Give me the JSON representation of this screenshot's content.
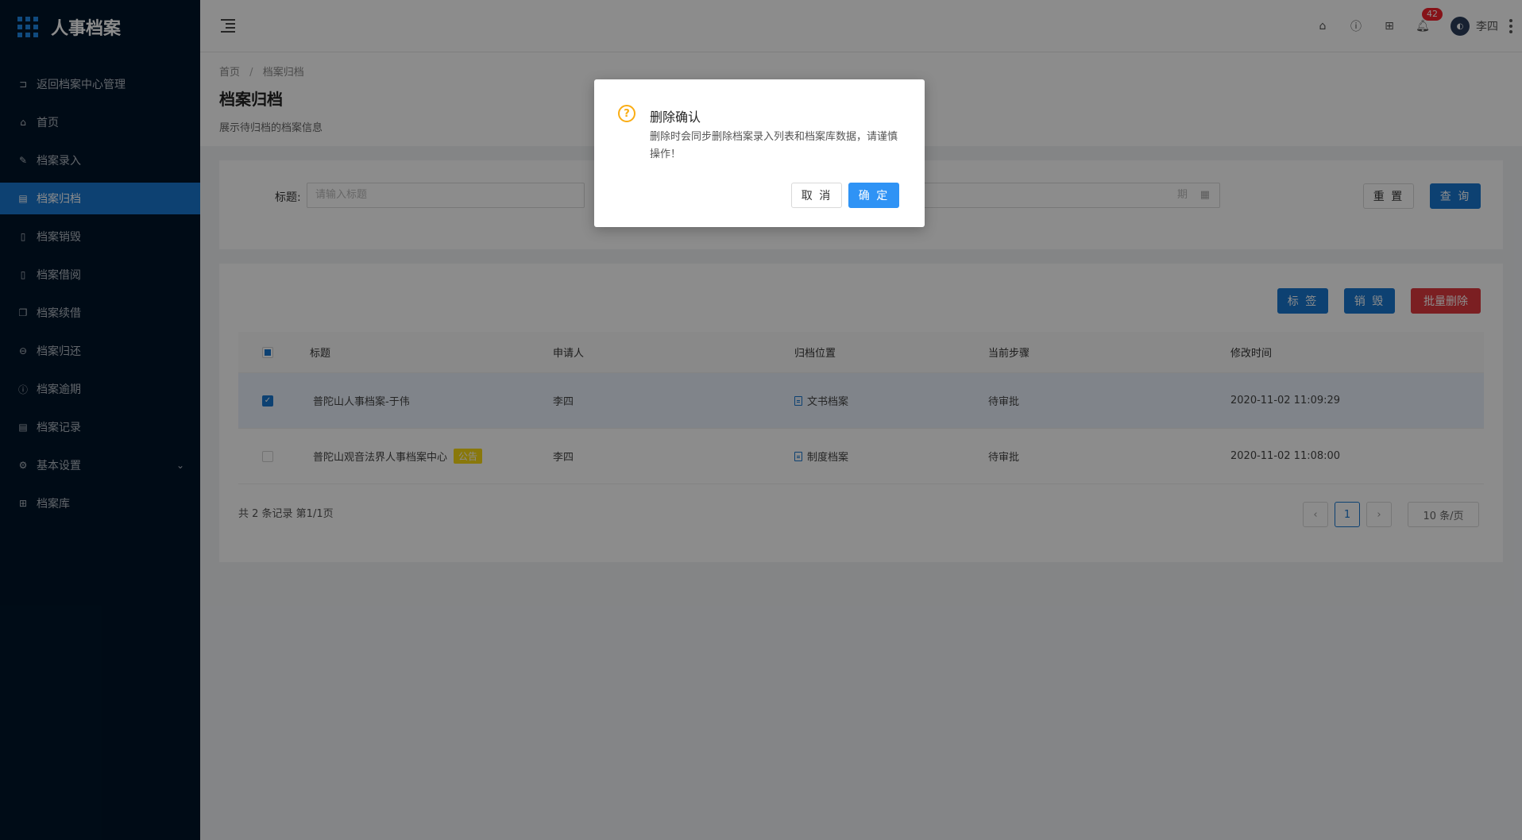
{
  "app": {
    "title": "人事档案"
  },
  "sidebar": {
    "items": [
      {
        "label": "返回档案中心管理",
        "icon": "return-icon"
      },
      {
        "label": "首页",
        "icon": "home-icon"
      },
      {
        "label": "档案录入",
        "icon": "edit-icon"
      },
      {
        "label": "档案归档",
        "icon": "archive-icon",
        "active": true
      },
      {
        "label": "档案销毁",
        "icon": "trash-icon"
      },
      {
        "label": "档案借阅",
        "icon": "file-icon"
      },
      {
        "label": "档案续借",
        "icon": "copy-icon"
      },
      {
        "label": "档案归还",
        "icon": "lock-icon"
      },
      {
        "label": "档案逾期",
        "icon": "alert-icon"
      },
      {
        "label": "档案记录",
        "icon": "record-icon"
      },
      {
        "label": "基本设置",
        "icon": "gear-icon",
        "has_submenu": true
      },
      {
        "label": "档案库",
        "icon": "grid-icon"
      }
    ]
  },
  "header": {
    "notifications_count": "42",
    "username": "李四"
  },
  "page": {
    "breadcrumb": [
      "首页",
      "档案归档"
    ],
    "title": "档案归档",
    "description": "展示待归档的档案信息"
  },
  "search": {
    "title_label": "标题:",
    "title_placeholder": "请输入标题",
    "date_placeholder": "期",
    "reset_label": "重 置",
    "query_label": "查 询"
  },
  "toolbar": {
    "tag_label": "标 签",
    "destroy_label": "销 毁",
    "batch_delete_label": "批量删除"
  },
  "table": {
    "columns": [
      "标题",
      "申请人",
      "归档位置",
      "当前步骤",
      "修改时间"
    ],
    "rows": [
      {
        "title": "普陀山人事档案-于伟",
        "applicant": "李四",
        "location": "文书档案",
        "step": "待审批",
        "modified": "2020-11-02 11:09:29",
        "checked": true,
        "tag": ""
      },
      {
        "title": "普陀山观音法界人事档案中心",
        "applicant": "李四",
        "location": "制度档案",
        "step": "待审批",
        "modified": "2020-11-02 11:08:00",
        "checked": false,
        "tag": "公告"
      }
    ]
  },
  "pagination": {
    "summary": "共 2 条记录 第1/1页",
    "prev": "‹",
    "current": "1",
    "next": "›",
    "page_size": "10 条/页"
  },
  "modal": {
    "title": "删除确认",
    "content": "删除时会同步删除档案录入列表和档案库数据，请谨慎操作！",
    "cancel_label": "取 消",
    "ok_label": "确 定"
  },
  "colors": {
    "sidebar_bg": "#001529",
    "primary": "#1877d0",
    "danger": "#e0393e",
    "warning": "#faad14"
  }
}
